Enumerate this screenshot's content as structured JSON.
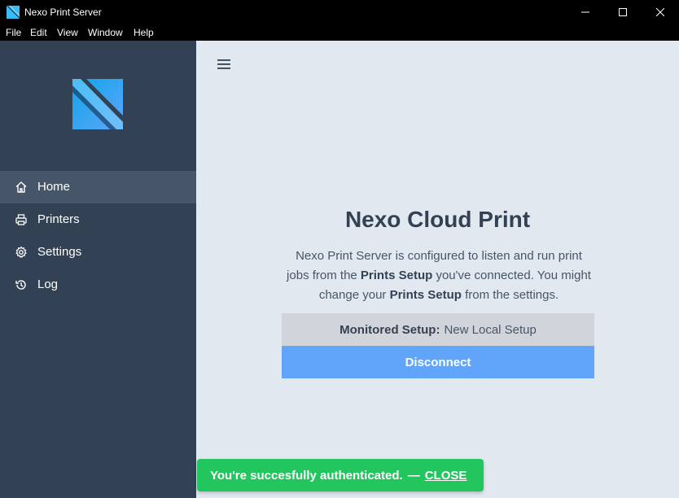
{
  "window": {
    "title": "Nexo Print Server",
    "app_icon": "nexo-logo-icon",
    "controls": [
      "minimize-icon",
      "maximize-icon",
      "close-icon"
    ]
  },
  "menu": {
    "file": "File",
    "edit": "Edit",
    "view": "View",
    "window": "Window",
    "help": "Help"
  },
  "sidebar": {
    "logo_icon": "nexo-logo-icon",
    "items": [
      {
        "label": "Home",
        "icon": "home-icon",
        "active": true
      },
      {
        "label": "Printers",
        "icon": "printer-icon",
        "active": false
      },
      {
        "label": "Settings",
        "icon": "gear-icon",
        "active": false
      },
      {
        "label": "Log",
        "icon": "history-icon",
        "active": false
      }
    ]
  },
  "main": {
    "menu_icon": "hamburger-icon",
    "heading": "Nexo Cloud Print",
    "description": {
      "part1": "Nexo Print Server is configured to listen and run print jobs from the ",
      "bold1": "Prints Setup",
      "part2": " you've connected. You might change your ",
      "bold2": "Prints Setup",
      "part3": " from the settings."
    },
    "monitored_label": "Monitored Setup:",
    "monitored_value": "New Local Setup",
    "disconnect_label": "Disconnect"
  },
  "toast": {
    "message": "You're succesfully authenticated.",
    "separator": "—",
    "close_label": "CLOSE"
  },
  "colors": {
    "sidebar_bg": "#334155",
    "sidebar_active_bg": "#475569",
    "main_bg": "#e2e8f0",
    "disconnect_bg": "#60a5fa",
    "monitor_bg": "#d1d5db",
    "toast_bg": "#22c55e",
    "logo_blue": "#38bdf8"
  }
}
